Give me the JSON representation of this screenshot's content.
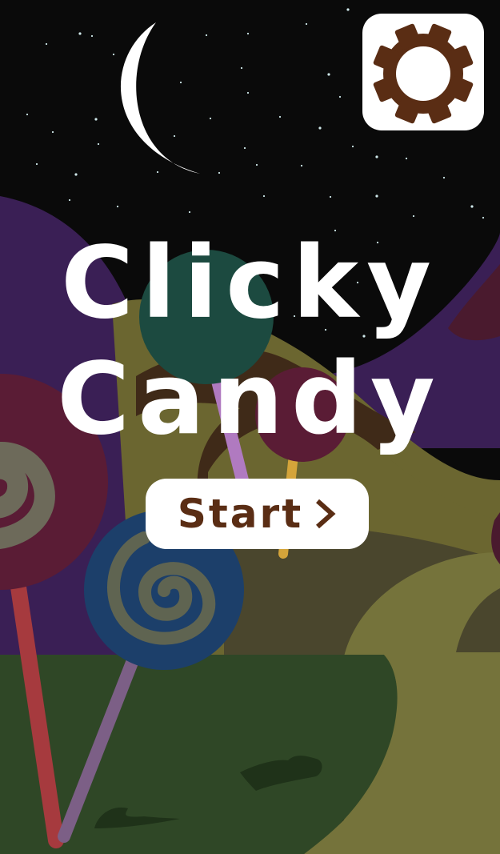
{
  "game": {
    "title_line1": "Clicky",
    "title_line2": "Candy"
  },
  "menu": {
    "start_label": "Start",
    "start_icon": "chevron-right-icon",
    "settings_icon": "gear-icon"
  },
  "colors": {
    "sky": "#0a0a0a",
    "hill_purple": "#3a1f55",
    "hill_olive": "#6b6630",
    "hill_brown": "#3f2a18",
    "ground_green": "#2f4726",
    "button_text": "#5a2d14",
    "gear": "#5a2d14",
    "button_bg": "#ffffff"
  }
}
